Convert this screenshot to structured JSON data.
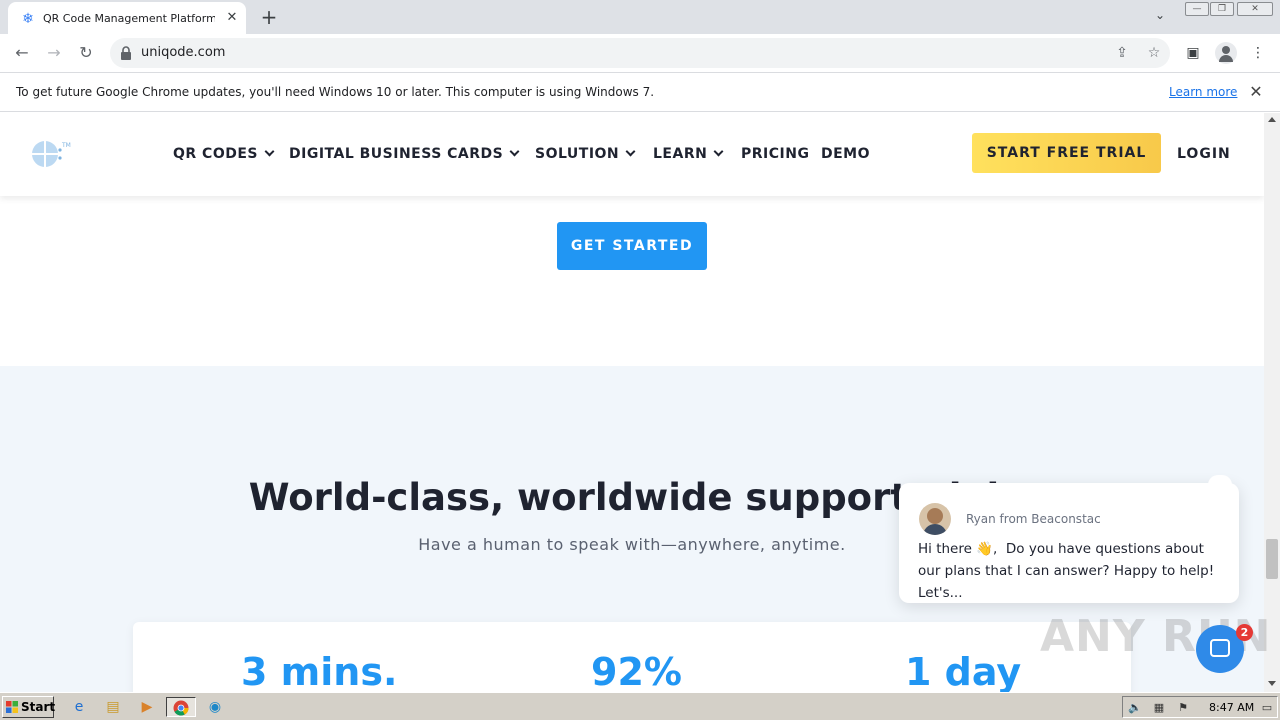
{
  "browser": {
    "tab_title": "QR Code Management Platform for m",
    "tab_favicon": "snowflake-icon",
    "new_tab_label": "+",
    "url": "uniqode.com",
    "infobar_text": "To get future Google Chrome updates, you'll need Windows 10 or later. This computer is using Windows 7.",
    "infobar_link": "Learn more"
  },
  "site": {
    "nav": {
      "items": [
        "QR CODES",
        "DIGITAL BUSINESS CARDS",
        "SOLUTION",
        "LEARN",
        "PRICING",
        "DEMO"
      ],
      "cta": "START FREE TRIAL",
      "login": "LOGIN"
    },
    "hero_button": "GET STARTED",
    "support": {
      "title": "World-class, worldwide support, del",
      "subtitle": "Have a human to speak with—anywhere, anytime.",
      "stats": [
        "3 mins.",
        "92%",
        "1 day"
      ]
    },
    "colors": {
      "primary": "#2196f3",
      "cta_yellow": "#ffe15d",
      "support_bg": "#f1f6fb"
    }
  },
  "chat": {
    "agent": "Ryan from Beaconstac",
    "message_start": "Hi there",
    "emoji": "👋",
    "message_rest": "Do you have questions about our plans that I can answer? Happy to help! Let's...",
    "badge_count": "2"
  },
  "watermark": "ANY RUN",
  "taskbar": {
    "start_label": "Start",
    "clock": "8:47 AM"
  }
}
